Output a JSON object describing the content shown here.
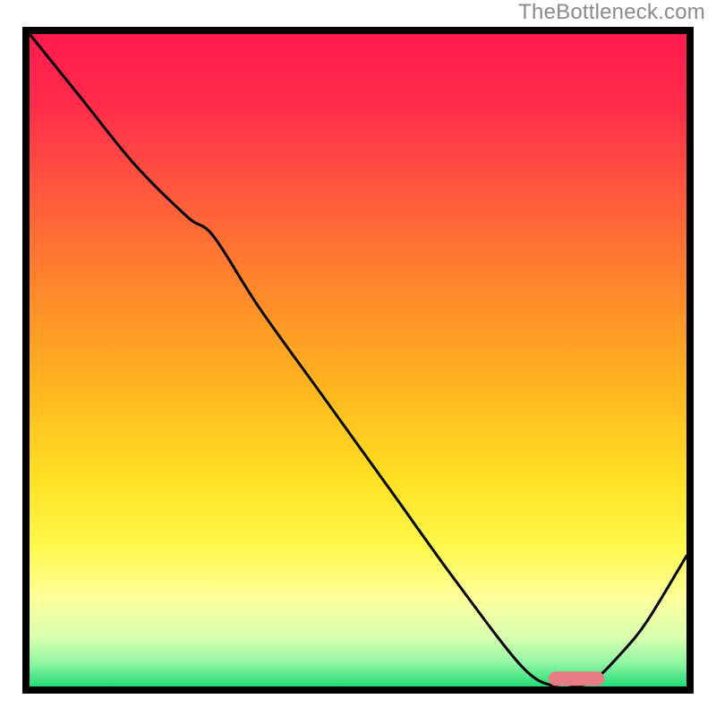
{
  "watermark": "TheBottleneck.com",
  "chart_data": {
    "type": "line",
    "title": "",
    "xlabel": "",
    "ylabel": "",
    "xlim": [
      0,
      100
    ],
    "ylim": [
      0,
      100
    ],
    "grid": false,
    "legend": false,
    "background_gradient_stops": [
      {
        "offset": 0.0,
        "color": "#ff1a4f"
      },
      {
        "offset": 0.12,
        "color": "#ff2e4a"
      },
      {
        "offset": 0.25,
        "color": "#ff5a3d"
      },
      {
        "offset": 0.4,
        "color": "#ff8a2a"
      },
      {
        "offset": 0.55,
        "color": "#ffb81f"
      },
      {
        "offset": 0.68,
        "color": "#ffe024"
      },
      {
        "offset": 0.78,
        "color": "#fff84a"
      },
      {
        "offset": 0.86,
        "color": "#fdff9a"
      },
      {
        "offset": 0.92,
        "color": "#d9ffb0"
      },
      {
        "offset": 0.96,
        "color": "#8ef5a2"
      },
      {
        "offset": 1.0,
        "color": "#14d66e"
      }
    ],
    "series": [
      {
        "name": "bottleneck-curve",
        "x": [
          0,
          8,
          16,
          24,
          28,
          35,
          45,
          55,
          65,
          75,
          80,
          83,
          86,
          90,
          94,
          100
        ],
        "y": [
          100,
          90,
          80,
          72,
          69,
          58,
          44,
          30,
          16,
          3,
          0,
          0,
          1,
          5,
          10,
          20
        ]
      }
    ],
    "marker": {
      "name": "optimal-range",
      "x_start": 79,
      "x_end": 87.5,
      "y": 1.2,
      "color": "#e77c85",
      "height_pct": 2.2
    },
    "frame_color": "#000000",
    "frame_stroke_px": 8
  }
}
